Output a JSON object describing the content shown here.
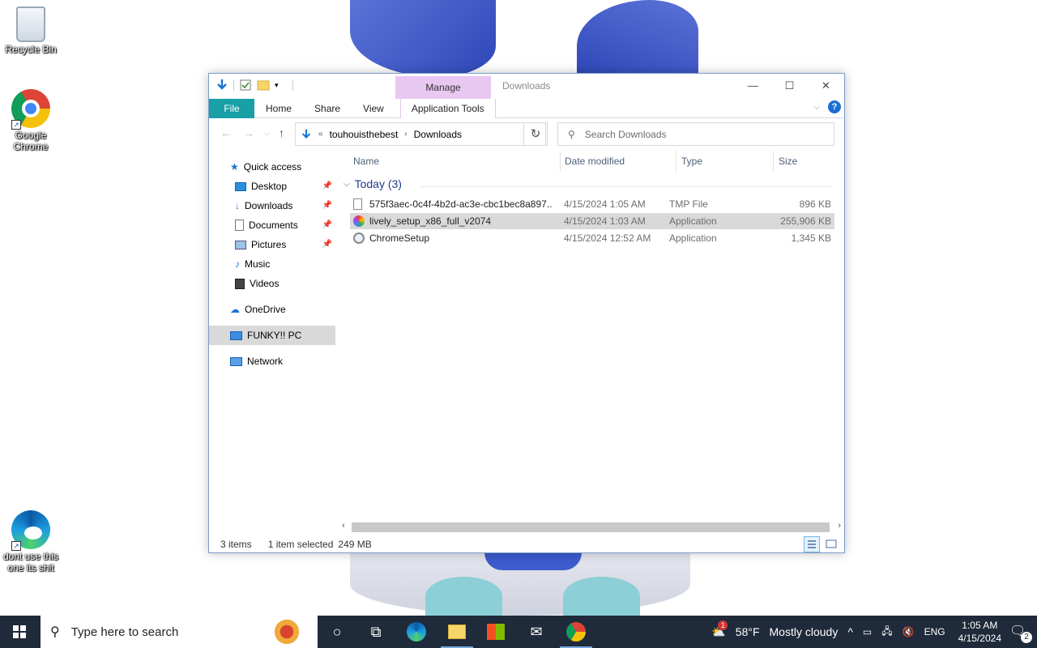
{
  "desktop": {
    "icons": [
      {
        "label": "Recycle Bin",
        "icon": "recycle-bin-icon"
      },
      {
        "label": "Google Chrome",
        "icon": "chrome-icon"
      },
      {
        "label": "dont use this one its shit",
        "icon": "edge-icon"
      }
    ]
  },
  "window": {
    "title": "Downloads",
    "context_tab_group": "Manage",
    "ribbon_tabs": [
      "File",
      "Home",
      "Share",
      "View",
      "Application Tools"
    ],
    "controls": {
      "minimize": "—",
      "maximize": "☐",
      "close": "✕"
    },
    "help": "?"
  },
  "navigation": {
    "breadcrumb_prefix": "«",
    "breadcrumb": [
      "touhouisthebest",
      "Downloads"
    ],
    "search_placeholder": "Search Downloads"
  },
  "nav_pane": {
    "quick_access": "Quick access",
    "items": [
      {
        "label": "Desktop",
        "pinned": true,
        "icon": "desktop-icon"
      },
      {
        "label": "Downloads",
        "pinned": true,
        "icon": "downloads-icon"
      },
      {
        "label": "Documents",
        "pinned": true,
        "icon": "documents-icon"
      },
      {
        "label": "Pictures",
        "pinned": true,
        "icon": "pictures-icon"
      },
      {
        "label": "Music",
        "pinned": false,
        "icon": "music-icon"
      },
      {
        "label": "Videos",
        "pinned": false,
        "icon": "videos-icon"
      }
    ],
    "onedrive": "OneDrive",
    "this_pc": "FUNKY!! PC",
    "network": "Network"
  },
  "file_list": {
    "columns": [
      "Name",
      "Date modified",
      "Type",
      "Size"
    ],
    "group": "Today (3)",
    "rows": [
      {
        "name": "575f3aec-0c4f-4b2d-ac3e-cbc1bec8a897....",
        "date": "4/15/2024 1:05 AM",
        "type": "TMP File",
        "size": "896 KB",
        "selected": false
      },
      {
        "name": "lively_setup_x86_full_v2074",
        "date": "4/15/2024 1:03 AM",
        "type": "Application",
        "size": "255,906 KB",
        "selected": true
      },
      {
        "name": "ChromeSetup",
        "date": "4/15/2024 12:52 AM",
        "type": "Application",
        "size": "1,345 KB",
        "selected": false
      }
    ]
  },
  "status": {
    "item_count": "3 items",
    "selection": "1 item selected",
    "selection_size": "249 MB"
  },
  "taskbar": {
    "search_placeholder": "Type here to search",
    "weather_temp": "58°F",
    "weather_desc": "Mostly cloudy",
    "weather_alert": "1",
    "language": "ENG",
    "time": "1:05 AM",
    "date": "4/15/2024",
    "notifications": "2"
  },
  "colors": {
    "file_tab": "#19a0a6",
    "manage_tab": "#e8c7f1",
    "taskbar": "#1f2a3a",
    "selection": "#d9d9d9"
  }
}
